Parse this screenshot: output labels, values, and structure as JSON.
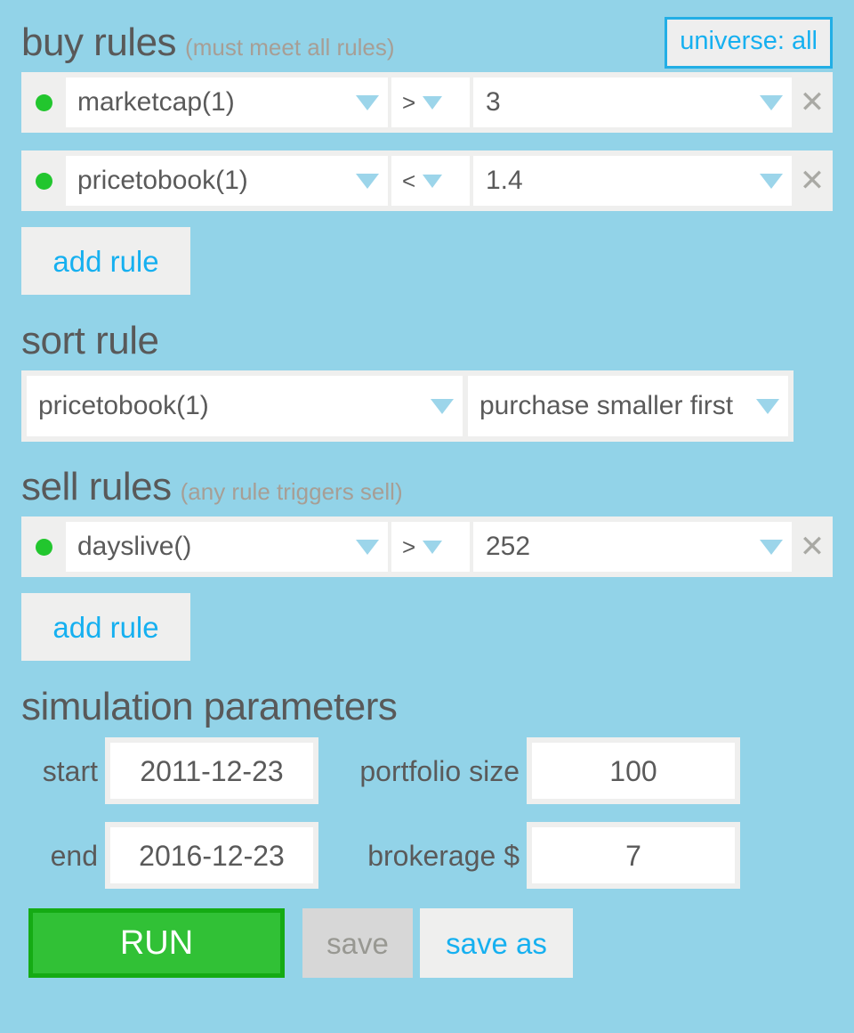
{
  "universe_button": {
    "label": "universe: all"
  },
  "buy_rules": {
    "title": "buy rules",
    "note": "(must meet all rules)",
    "add_label": "add rule",
    "rows": [
      {
        "status_dot": "active-green",
        "metric": "marketcap(1)",
        "operator": ">",
        "value": "3",
        "remove_label": "✕"
      },
      {
        "status_dot": "active-green",
        "metric": "pricetobook(1)",
        "operator": "<",
        "value": "1.4",
        "remove_label": "✕"
      }
    ]
  },
  "sort_rule": {
    "title": "sort rule",
    "metric": "pricetobook(1)",
    "direction": "purchase smaller first"
  },
  "sell_rules": {
    "title": "sell rules",
    "note": "(any rule triggers sell)",
    "add_label": "add rule",
    "rows": [
      {
        "status_dot": "active-green",
        "metric": "dayslive()",
        "operator": ">",
        "value": "252",
        "remove_label": "✕"
      }
    ]
  },
  "simulation_parameters": {
    "title": "simulation parameters",
    "start_label": "start",
    "start_value": "2011-12-23",
    "end_label": "end",
    "end_value": "2016-12-23",
    "portfolio_size_label": "portfolio size",
    "portfolio_size_value": "100",
    "brokerage_label": "brokerage $",
    "brokerage_value": "7"
  },
  "actions": {
    "run_label": "RUN",
    "save_label": "save",
    "save_as_label": "save as"
  },
  "colors": {
    "background": "#92d3e8",
    "accent_blue": "#16b0f0",
    "status_green": "#22c62e",
    "run_green": "#31c136",
    "run_green_border": "#15ab14",
    "field_bg": "#ffffff",
    "row_bg": "#efefee",
    "text_gray": "#5a5a5a",
    "note_gray": "#a79e95",
    "caret_blue": "#9cd5ea",
    "remove_gray": "#a9a9a4",
    "save_disabled_bg": "#d7d7d7",
    "save_disabled_text": "#989892"
  }
}
